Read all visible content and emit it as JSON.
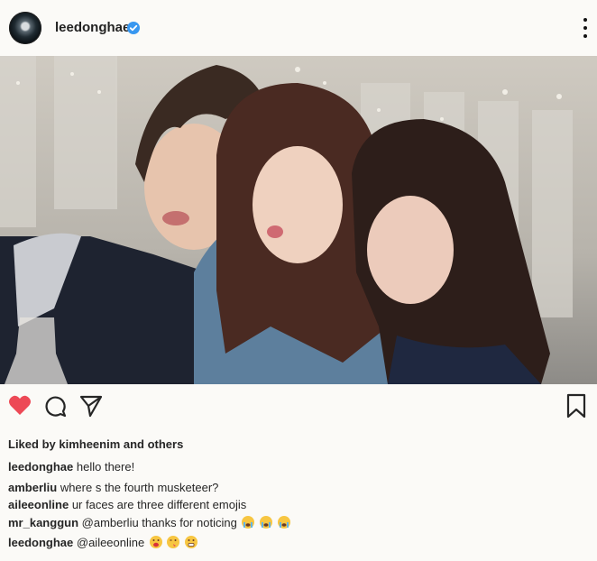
{
  "post": {
    "username": "leedonghae",
    "verified": true,
    "liked_by_text": "Liked by kimheenim and others"
  },
  "comments": [
    {
      "user": "leedonghae",
      "text": "hello there!",
      "emojis": []
    },
    {
      "user": "amberliu",
      "text": "where s the fourth musketeer?",
      "emojis": []
    },
    {
      "user": "aileeonline",
      "text": "ur faces are three different emojis",
      "emojis": []
    },
    {
      "user": "mr_kanggun",
      "text": "@amberliu thanks for noticing",
      "emojis": [
        "crying-face",
        "crying-face",
        "crying-face"
      ]
    },
    {
      "user": "leedonghae",
      "text": "@aileeonline",
      "emojis": [
        "tongue-face",
        "winking-tongue-face",
        "grimacing-face"
      ]
    }
  ],
  "colors": {
    "heart": "#ed4956",
    "verified": "#3897f0",
    "text": "#262626"
  }
}
